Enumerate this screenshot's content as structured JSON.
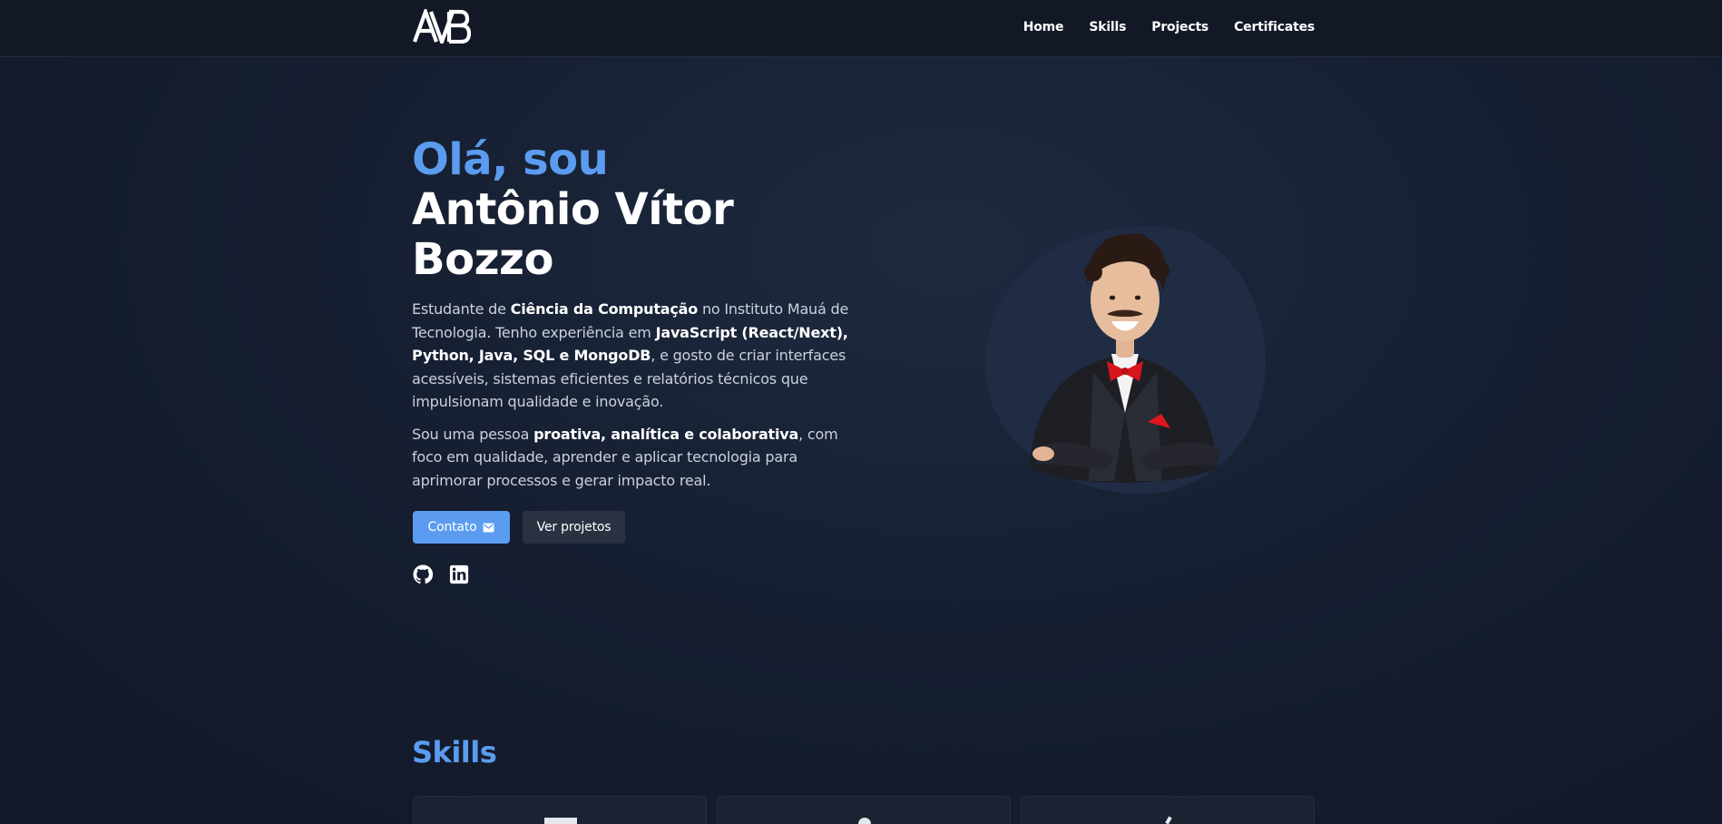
{
  "nav": {
    "logo_text": "AVB",
    "links": [
      "Home",
      "Skills",
      "Projects",
      "Certificates"
    ]
  },
  "hero": {
    "greeting": "Olá, sou",
    "name": "Antônio Vítor Bozzo",
    "bio1": {
      "t1": "Estudante de ",
      "b1": "Ciência da Computação",
      "t2": " no Instituto Mauá de Tecnologia. Tenho experiência em ",
      "b2": "JavaScript (React/Next), Python, Java, SQL e MongoDB",
      "t3": ", e gosto de criar interfaces acessíveis, sistemas eficientes e relatórios técnicos que impulsionam qualidade e inovação."
    },
    "bio2": {
      "t1": "Sou uma pessoa ",
      "b1": "proativa, analítica e colaborativa",
      "t2": ", com foco em qualidade, aprender e aplicar tecnologia para aprimorar processos e gerar impacto real."
    },
    "contact_button": "Contato",
    "projects_button": "Ver projetos",
    "socials": [
      "github-icon",
      "linkedin-icon"
    ]
  },
  "skills": {
    "title": "Skills"
  },
  "colors": {
    "accent": "#5b9cf0",
    "background": "#161f31",
    "navbar": "#121826",
    "button_secondary": "#2a3242"
  }
}
